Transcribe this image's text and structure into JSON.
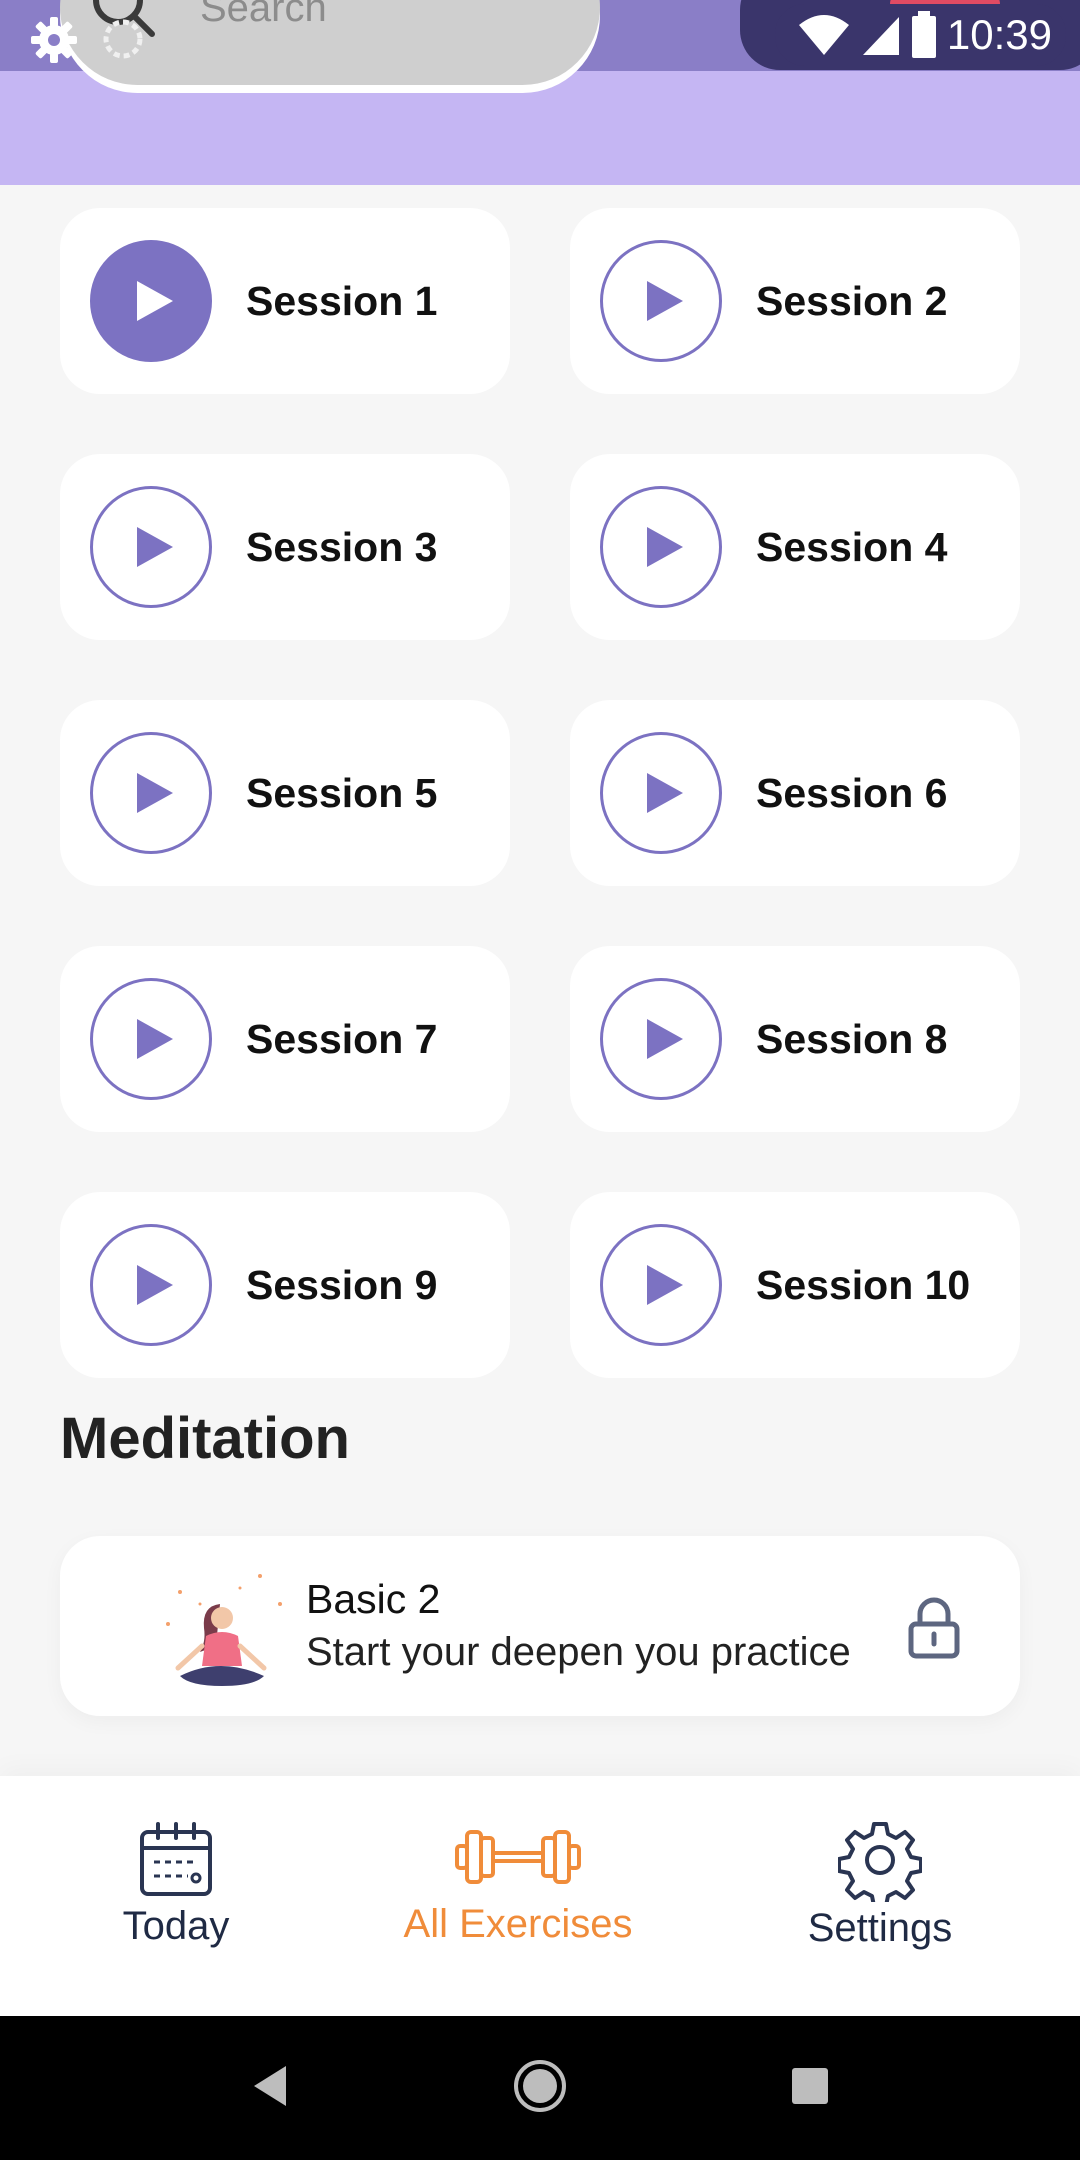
{
  "status_bar": {
    "time": "10:39"
  },
  "search": {
    "placeholder": "Search"
  },
  "sessions": [
    {
      "label": "Session 1",
      "active": true
    },
    {
      "label": "Session 2",
      "active": false
    },
    {
      "label": "Session 3",
      "active": false
    },
    {
      "label": "Session 4",
      "active": false
    },
    {
      "label": "Session 5",
      "active": false
    },
    {
      "label": "Session 6",
      "active": false
    },
    {
      "label": "Session 7",
      "active": false
    },
    {
      "label": "Session 8",
      "active": false
    },
    {
      "label": "Session 9",
      "active": false
    },
    {
      "label": "Session 10",
      "active": false
    }
  ],
  "meditation": {
    "section_title": "Meditation",
    "card": {
      "title": "Basic 2",
      "subtitle": "Start your deepen you practice",
      "locked": true
    }
  },
  "bottom_nav": {
    "items": [
      {
        "label": "Today",
        "icon": "calendar-icon",
        "active": false
      },
      {
        "label": "All Exercises",
        "icon": "dumbbell-icon",
        "active": true
      },
      {
        "label": "Settings",
        "icon": "gear-icon",
        "active": false
      }
    ]
  },
  "colors": {
    "accent": "#7c72c2",
    "header_bg": "#c5b6f3",
    "active_nav": "#f08c3a",
    "nav_text": "#1f2a44",
    "page_bg": "#f6f6f6"
  }
}
